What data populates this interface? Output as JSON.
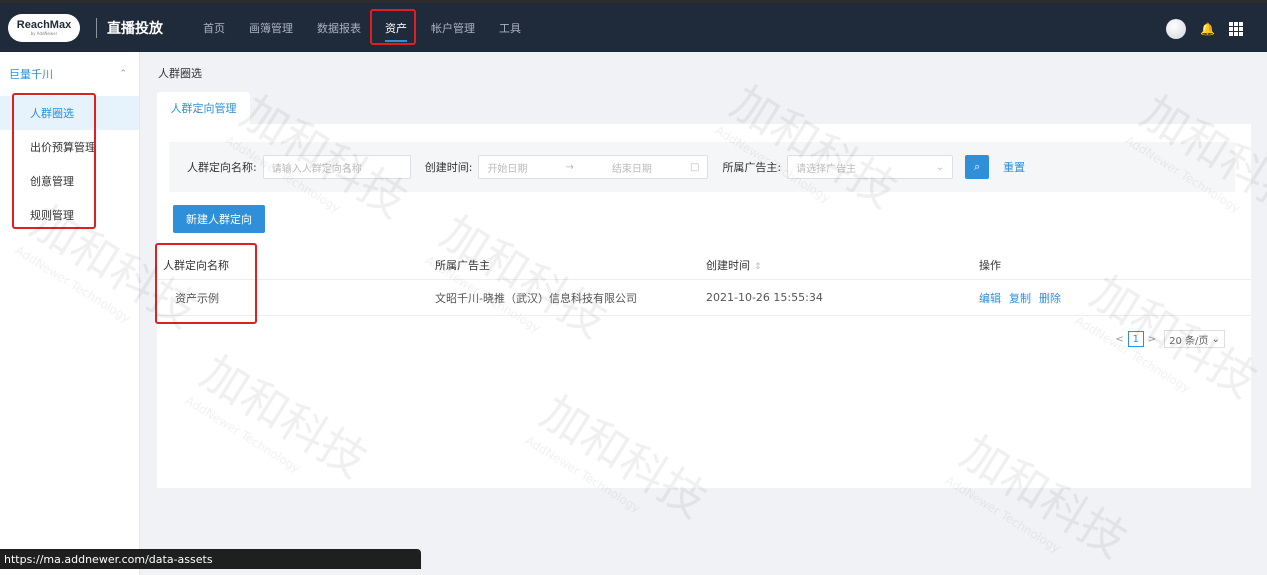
{
  "header": {
    "logo_text": "ReachMax",
    "logo_sub": "by AddNewer",
    "product": "直播投放",
    "nav": [
      "首页",
      "画簿管理",
      "数据报表",
      "资产",
      "帐户管理",
      "工具"
    ]
  },
  "sidebar": {
    "group": "巨量千川",
    "items": [
      "人群圈选",
      "出价预算管理",
      "创意管理",
      "规则管理"
    ]
  },
  "breadcrumb": "人群圈选",
  "tab": "人群定向管理",
  "filter": {
    "name_label": "人群定向名称:",
    "name_placeholder": "请输入人群定向名称",
    "time_label": "创建时间:",
    "start_placeholder": "开始日期",
    "arrow": "→",
    "end_placeholder": "结束日期",
    "advertiser_label": "所属广告主:",
    "advertiser_placeholder": "请选择广告主",
    "reset": "重置"
  },
  "new_button": "新建人群定向",
  "table": {
    "headers": [
      "人群定向名称",
      "所属广告主",
      "创建时间",
      "操作"
    ],
    "rows": [
      {
        "name": "资产示例",
        "advertiser": "文昭千川-晓推（武汉）信息科技有限公司",
        "created": "2021-10-26 15:55:34",
        "ops": [
          "编辑",
          "复制",
          "删除"
        ]
      }
    ]
  },
  "pager": {
    "prev": "<",
    "page": "1",
    "next": ">",
    "size": "20 条/页"
  },
  "watermark": {
    "text": "加和科技",
    "sub": "AddNewer Technology"
  },
  "status_url": "https://ma.addnewer.com/data-assets"
}
